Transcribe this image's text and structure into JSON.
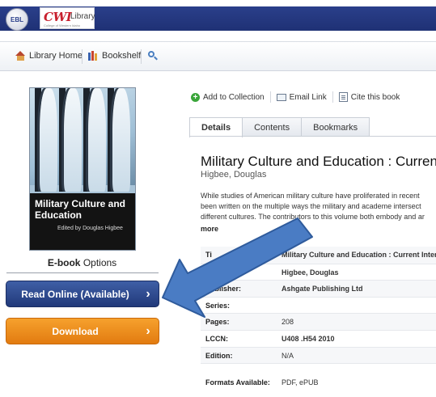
{
  "header": {
    "ebl_logo_text": "EBL",
    "library_logo_text": "CWI",
    "library_logo_word": "Library",
    "library_logo_sub": "College of Western Idaho"
  },
  "nav": {
    "library_home": "Library Home",
    "bookshelf": "Bookshelf"
  },
  "cover": {
    "title": "Military Culture and Education",
    "author_line": "Edited by Douglas Higbee"
  },
  "left": {
    "options_bold": "E-book",
    "options_rest": " Options",
    "read_online": "Read Online (Available)",
    "download": "Download",
    "chevron": "›"
  },
  "actions": {
    "add_to_collection": "Add to Collection",
    "email_link": "Email Link",
    "cite": "Cite this book"
  },
  "tabs": [
    "Details",
    "Contents",
    "Bookmarks"
  ],
  "book": {
    "title": "Military Culture and Education : Current",
    "author": "Higbee, Douglas",
    "description_lines": [
      "While studies of American military culture have proliferated in recent",
      "been written on the multiple ways the military and academe intersect",
      "different cultures. The contributors to this volume both embody and ar"
    ],
    "more": "more"
  },
  "details": {
    "title_label": "Ti",
    "title_value": "Military Culture and Education : Current Interse",
    "author_label": "s):",
    "author_value": "Higbee, Douglas",
    "publisher_label": "Publisher:",
    "publisher_value": "Ashgate Publishing Ltd",
    "series_label": "Series:",
    "series_value": "",
    "pages_label": "Pages:",
    "pages_value": "208",
    "lccn_label": "LCCN:",
    "lccn_value": "U408 .H54 2010",
    "edition_label": "Edition:",
    "edition_value": "N/A",
    "formats_label": "Formats Available:",
    "formats_value": "PDF, ePUB"
  },
  "colors": {
    "header_blue": "#1f3175",
    "read_button": "#2a468c",
    "download_button": "#ec8c1e",
    "arrow": "#4a7cc4"
  }
}
